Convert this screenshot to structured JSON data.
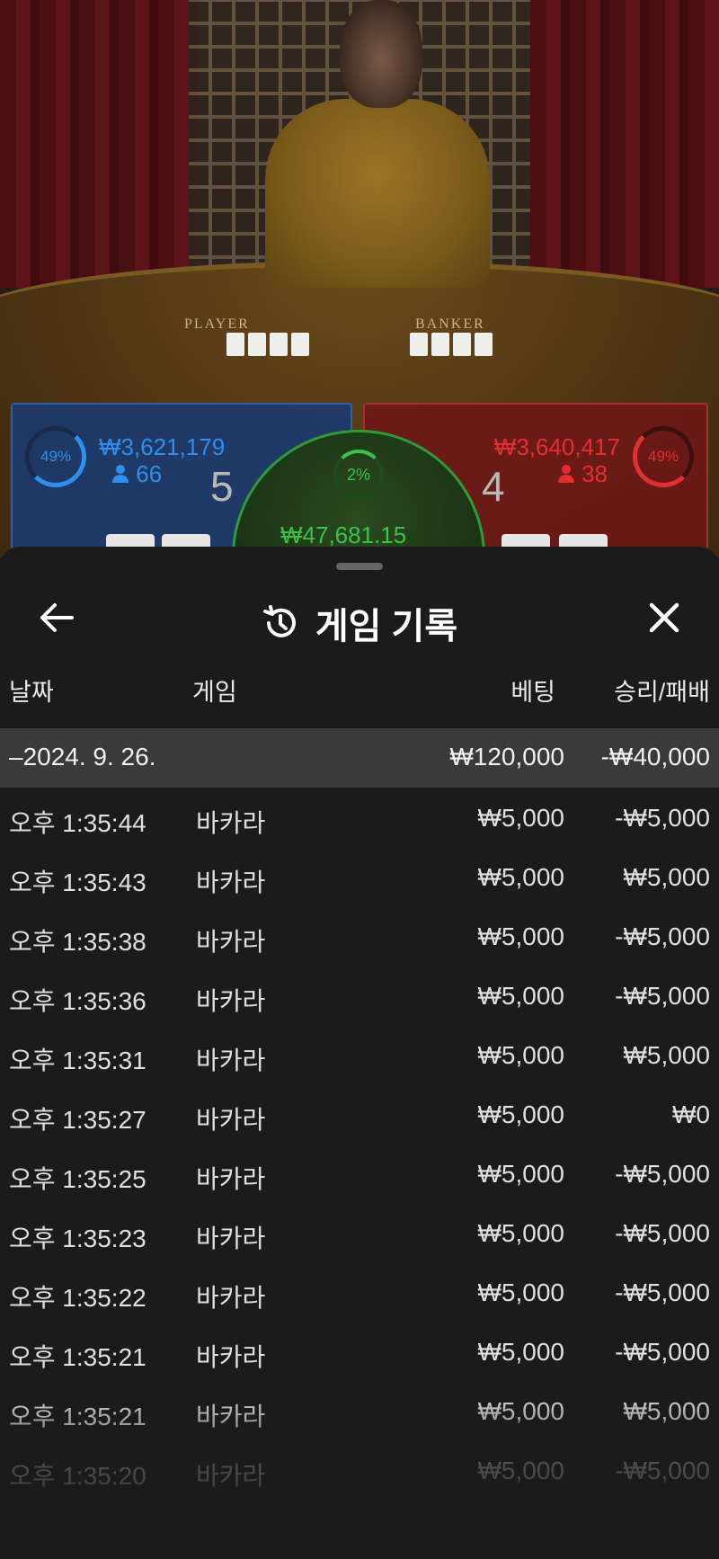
{
  "table": {
    "player_label": "PLAYER",
    "banker_label": "BANKER",
    "player": {
      "percent": "49%",
      "amount": "₩3,621,179",
      "count": "66",
      "score": "5"
    },
    "banker": {
      "percent": "49%",
      "amount": "₩3,640,417",
      "count": "38",
      "score": "4"
    },
    "tie": {
      "percent": "2%",
      "amount": "₩47,681.15"
    },
    "colors": {
      "player": "#2f8ff0",
      "banker": "#e23030",
      "tie": "#3cc24a"
    }
  },
  "sheet": {
    "title": "게임 기록",
    "icons": {
      "back": "arrow-left-icon",
      "title": "history-icon",
      "close": "close-icon"
    },
    "columns": {
      "date": "날짜",
      "game": "게임",
      "bet": "베팅",
      "win_loss": "승리/패배"
    },
    "date_group": {
      "label": "–2024. 9. 26.",
      "bet_total": "₩120,000",
      "win_total": "-₩40,000"
    },
    "rows": [
      {
        "time": "오후 1:35:44",
        "game": "바카라",
        "bet": "₩5,000",
        "result": "-₩5,000"
      },
      {
        "time": "오후 1:35:43",
        "game": "바카라",
        "bet": "₩5,000",
        "result": "₩5,000"
      },
      {
        "time": "오후 1:35:38",
        "game": "바카라",
        "bet": "₩5,000",
        "result": "-₩5,000"
      },
      {
        "time": "오후 1:35:36",
        "game": "바카라",
        "bet": "₩5,000",
        "result": "-₩5,000"
      },
      {
        "time": "오후 1:35:31",
        "game": "바카라",
        "bet": "₩5,000",
        "result": "₩5,000"
      },
      {
        "time": "오후 1:35:27",
        "game": "바카라",
        "bet": "₩5,000",
        "result": "₩0"
      },
      {
        "time": "오후 1:35:25",
        "game": "바카라",
        "bet": "₩5,000",
        "result": "-₩5,000"
      },
      {
        "time": "오후 1:35:23",
        "game": "바카라",
        "bet": "₩5,000",
        "result": "-₩5,000"
      },
      {
        "time": "오후 1:35:22",
        "game": "바카라",
        "bet": "₩5,000",
        "result": "-₩5,000"
      },
      {
        "time": "오후 1:35:21",
        "game": "바카라",
        "bet": "₩5,000",
        "result": "-₩5,000"
      },
      {
        "time": "오후 1:35:21",
        "game": "바카라",
        "bet": "₩5,000",
        "result": "₩5,000"
      },
      {
        "time": "오후 1:35:20",
        "game": "바카라",
        "bet": "₩5,000",
        "result": "-₩5,000"
      }
    ]
  }
}
